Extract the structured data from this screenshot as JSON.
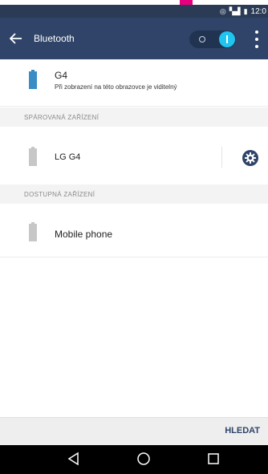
{
  "status_bar": {
    "time": "12:0"
  },
  "app_bar": {
    "title": "Bluetooth",
    "toggle_on": true
  },
  "own_device": {
    "name": "G4",
    "subtitle": "Při zobrazení na této obrazovce je viditelný"
  },
  "paired_section": {
    "title": "SPÁROVANÁ ZAŘÍZENÍ"
  },
  "paired_devices": [
    {
      "name": "LG G4"
    }
  ],
  "available_section": {
    "title": "DOSTUPNÁ ZAŘÍZENÍ"
  },
  "available_devices": [
    {
      "name": "Mobile phone"
    }
  ],
  "bottom_bar": {
    "search_label": "HLEDAT"
  },
  "colors": {
    "status_bar": "#2b3a55",
    "app_bar": "#2f4468",
    "toggle_knob": "#20c4ef",
    "battery_blue": "#3a8cc4",
    "battery_gray": "#c7c7c7",
    "pink_marker": "#e6007e"
  },
  "icons": {
    "back": "arrow-left-icon",
    "settings": "gear-icon",
    "overflow": "more-vertical-icon",
    "nav_back": "triangle-back-icon",
    "nav_home": "circle-home-icon",
    "nav_recent": "square-recent-icon"
  }
}
